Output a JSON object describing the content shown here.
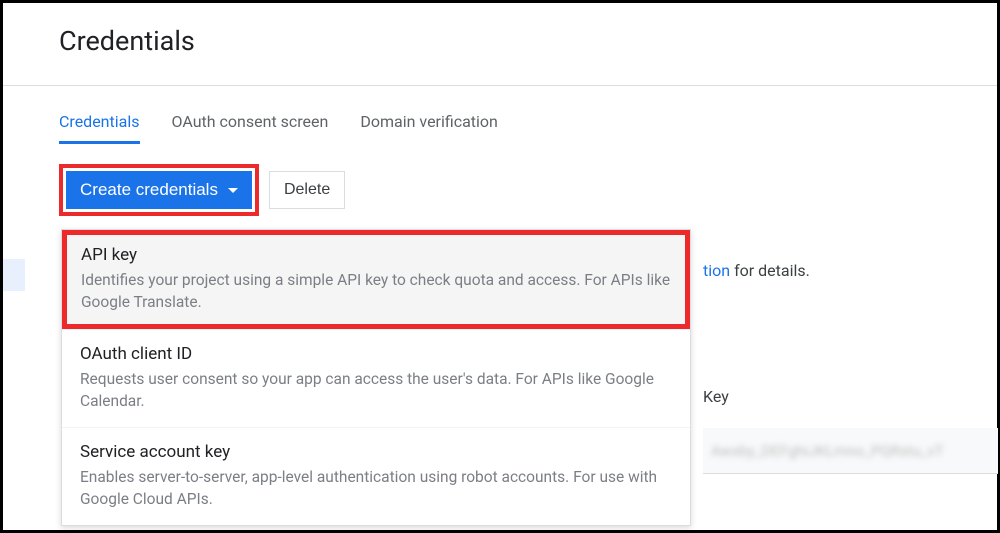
{
  "header": {
    "title": "Credentials"
  },
  "tabs": {
    "items": [
      {
        "label": "Credentials",
        "active": true
      },
      {
        "label": "OAuth consent screen",
        "active": false
      },
      {
        "label": "Domain verification",
        "active": false
      }
    ]
  },
  "toolbar": {
    "create_label": "Create credentials",
    "delete_label": "Delete"
  },
  "dropdown": {
    "items": [
      {
        "title": "API key",
        "desc": "Identifies your project using a simple API key to check quota and access. For APIs like Google Translate.",
        "highlighted": true
      },
      {
        "title": "OAuth client ID",
        "desc": "Requests user consent so your app can access the user's data. For APIs like Google Calendar.",
        "highlighted": false
      },
      {
        "title": "Service account key",
        "desc": "Enables server-to-server, app-level authentication using robot accounts. For use with Google Cloud APIs.",
        "highlighted": false
      }
    ]
  },
  "partial": {
    "link_fragment": "tion",
    "suffix": " for details.",
    "key_header": "Key",
    "blurred": "Awxby_DEFghiJKLmno_PQRstu_vT"
  },
  "annotation": {
    "highlight_color": "#ec2a2b"
  }
}
